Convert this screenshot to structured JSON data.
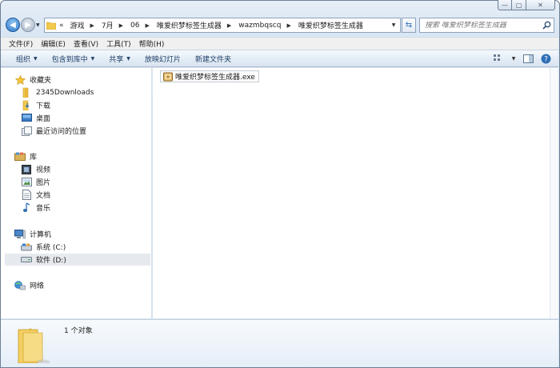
{
  "window": {
    "minimize_glyph": "—",
    "maximize_glyph": "▢",
    "close_glyph": "✕"
  },
  "address": {
    "overflow": "«",
    "crumbs": [
      {
        "label": "游戏"
      },
      {
        "label": "7月"
      },
      {
        "label": "06"
      },
      {
        "label": "唯爱织梦标签生成器"
      },
      {
        "label": "wazmbqscq"
      },
      {
        "label": "唯爱织梦标签生成器"
      }
    ]
  },
  "search": {
    "placeholder": "搜索 唯爱织梦标签生成器"
  },
  "menu": {
    "items": [
      {
        "label": "文件(F)"
      },
      {
        "label": "编辑(E)"
      },
      {
        "label": "查看(V)"
      },
      {
        "label": "工具(T)"
      },
      {
        "label": "帮助(H)"
      }
    ]
  },
  "toolbar": {
    "organize": "组织",
    "include_in_library": "包含到库中",
    "share": "共享",
    "slideshow": "放映幻灯片",
    "new_folder": "新建文件夹"
  },
  "nav": {
    "favorites": "收藏夹",
    "downloads_2345": "2345Downloads",
    "downloads": "下载",
    "desktop": "桌面",
    "recent_places": "最近访问的位置",
    "libraries": "库",
    "videos": "视频",
    "pictures": "图片",
    "documents": "文档",
    "music": "音乐",
    "computer": "计算机",
    "drive_c": "系统 (C:)",
    "drive_d": "软件 (D:)",
    "network": "网络"
  },
  "files": [
    {
      "name": "唯爱织梦标签生成器.exe",
      "icon": "exe-app-icon"
    }
  ],
  "details": {
    "count_text": "1 个对象"
  },
  "colors": {
    "frame": "#d9e6f4",
    "accent": "#2f78c8",
    "selected_row": "#e6e9ee",
    "folder_yellow": "#f2c94c"
  }
}
